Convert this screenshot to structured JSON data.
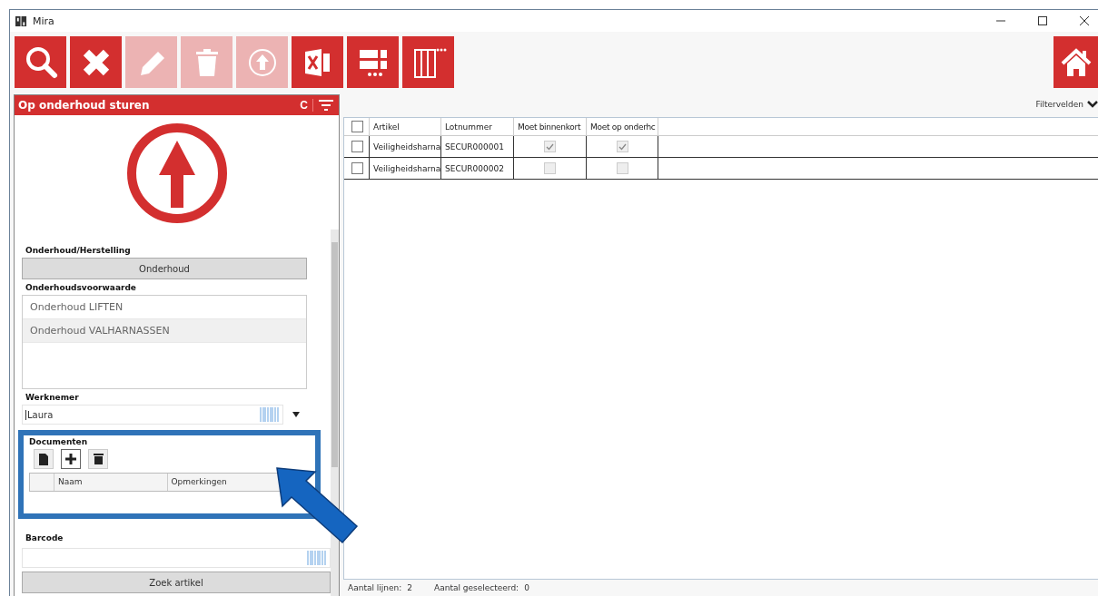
{
  "window": {
    "title": "Mira"
  },
  "toolbar": [
    {
      "kind": "search",
      "disabled": false
    },
    {
      "kind": "cancel",
      "disabled": false
    },
    {
      "kind": "edit",
      "disabled": true
    },
    {
      "kind": "delete",
      "disabled": true
    },
    {
      "kind": "upload",
      "disabled": true
    },
    {
      "kind": "excel",
      "disabled": false
    },
    {
      "kind": "form",
      "disabled": false
    },
    {
      "kind": "columns",
      "disabled": false
    }
  ],
  "panel": {
    "title": "Op onderhoud sturen",
    "refresh": "C",
    "type_label": "Onderhoud/Herstelling",
    "type_button": "Onderhoud",
    "condition_label": "Onderhoudsvoorwaarde",
    "conditions": [
      {
        "label": "Onderhoud LIFTEN",
        "selected": false
      },
      {
        "label": "Onderhoud VALHARNASSEN",
        "selected": true
      }
    ],
    "employee_label": "Werknemer",
    "employee_value": "Laura",
    "documents_label": "Documenten",
    "document_columns": [
      "Naam",
      "Opmerkingen"
    ],
    "barcode_label": "Barcode",
    "search_button": "Zoek artikel"
  },
  "filter": {
    "label": "Filtervelden",
    "expanded": false
  },
  "table": {
    "columns": [
      "Artikel",
      "Lotnummer",
      "Moet binnenkort",
      "Moet op onderhc"
    ],
    "all_selected": false,
    "rows": [
      {
        "selected": false,
        "artikel": "Veiligheidsharna",
        "lotnummer": "SECUR000001",
        "moet_binnenkort": true,
        "moet_op_onderhoud": true
      },
      {
        "selected": false,
        "artikel": "Veiligheidsharna",
        "lotnummer": "SECUR000002",
        "moet_binnenkort": false,
        "moet_op_onderhoud": false
      }
    ]
  },
  "status_bar": {
    "lines_label": "Aantal lijnen:",
    "lines": "2",
    "selected_label": "Aantal geselecteerd:",
    "selected": "0"
  }
}
